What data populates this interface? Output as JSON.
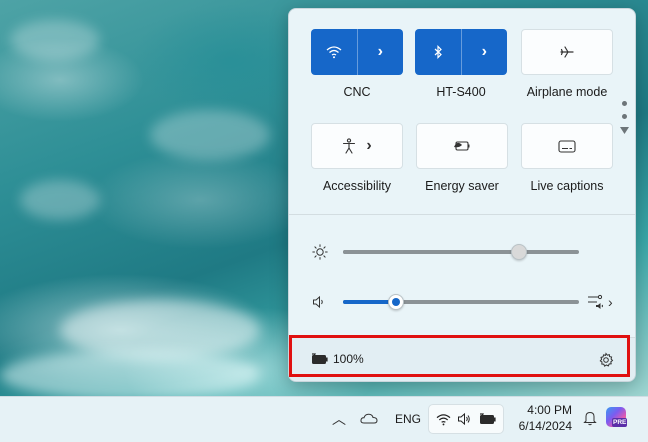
{
  "quick_settings": {
    "tiles": [
      {
        "label": "CNC",
        "icon": "wifi-icon",
        "state": "on",
        "has_arrow": true
      },
      {
        "label": "HT-S400",
        "icon": "bluetooth-icon",
        "state": "on",
        "has_arrow": true
      },
      {
        "label": "Airplane mode",
        "icon": "airplane-icon",
        "state": "off",
        "has_arrow": false
      },
      {
        "label": "Accessibility",
        "icon": "accessibility-icon",
        "state": "off",
        "has_arrow": true
      },
      {
        "label": "Energy saver",
        "icon": "energy-saver-icon",
        "state": "off",
        "has_arrow": false
      },
      {
        "label": "Live captions",
        "icon": "captions-icon",
        "state": "off",
        "has_arrow": false
      }
    ],
    "brightness": {
      "icon": "brightness-icon",
      "level_percent": 74
    },
    "volume": {
      "icon": "speaker-icon",
      "level_percent": 22,
      "audio_output_icon": "audio-output-icon"
    },
    "footer": {
      "battery_icon": "battery-charging-icon",
      "battery_text": "100%",
      "settings_icon": "gear-icon"
    }
  },
  "taskbar": {
    "language": "ENG",
    "time": "4:00 PM",
    "date": "6/14/2024",
    "copilot_badge": "PRE"
  },
  "colors": {
    "accent": "#1667c9",
    "highlight": "#e01010"
  }
}
